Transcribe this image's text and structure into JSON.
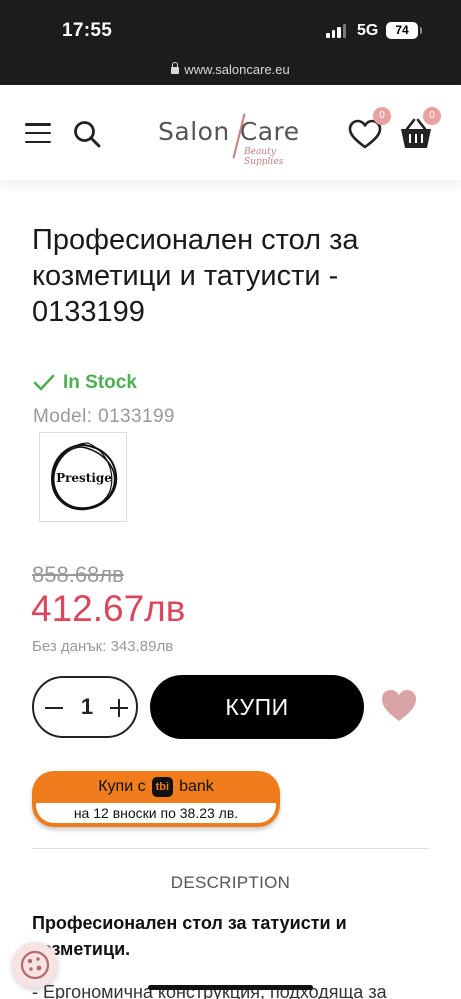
{
  "status": {
    "time": "17:55",
    "network": "5G",
    "battery": "74"
  },
  "browser": {
    "url": "www.saloncare.eu"
  },
  "header": {
    "logo_left": "Salon",
    "logo_right": "Care",
    "logo_tagline": "Beauty Supplies",
    "wishlist_count": "0",
    "cart_count": "0"
  },
  "product": {
    "title": "Професионален стол за козметици и татуисти - 0133199",
    "stock": "In Stock",
    "model_label": "Model:",
    "model": "0133199",
    "brand": "Prestige",
    "old_price": "858.68лв",
    "price": "412.67лв",
    "tax_label": "Без данък:",
    "tax_price": "343.89лв",
    "quantity": "1",
    "buy_label": "КУПИ"
  },
  "tbi": {
    "prefix": "Купи с",
    "logo": "tbi",
    "suffix": "bank",
    "installments": "на 12 вноски по 38.23 лв."
  },
  "description": {
    "tab_label": "DESCRIPTION",
    "heading": "Професионален стол за татуисти и козметици.",
    "first_line": "- Ергономична конструкция, подходяща за"
  },
  "colors": {
    "accent": "#d9475d",
    "stock_green": "#4caf50",
    "tbi_orange": "#f07c1c",
    "badge_pink": "#e8a0a3",
    "heart_pink": "#d9a3a6"
  }
}
